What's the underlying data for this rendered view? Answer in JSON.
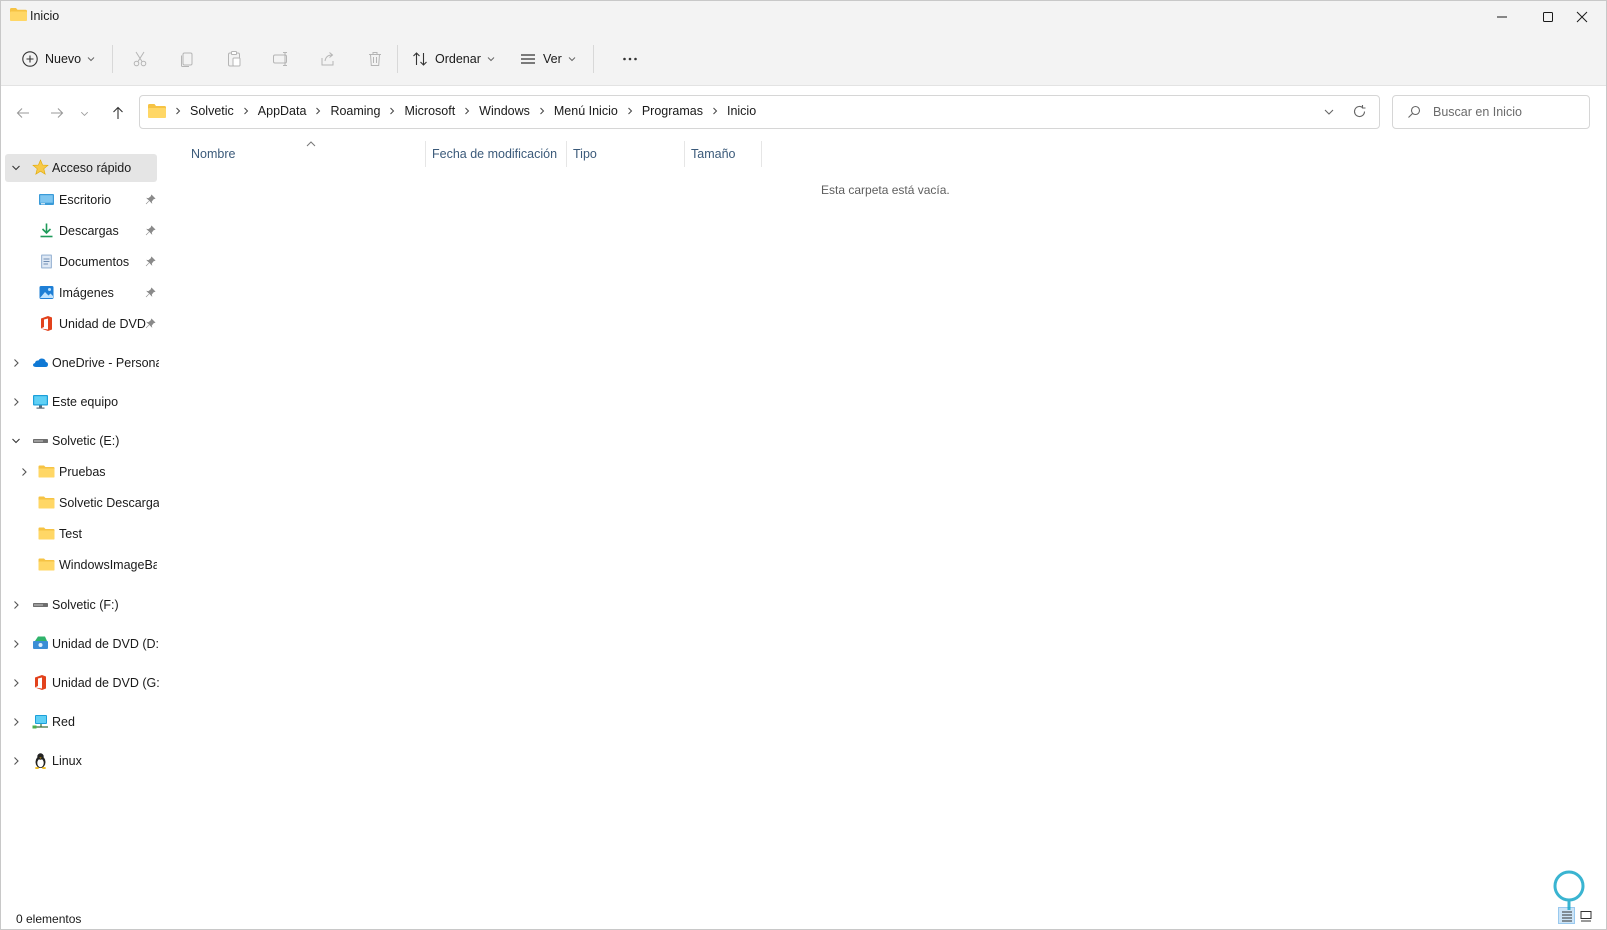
{
  "window": {
    "title": "Inicio",
    "controls": [
      "minimize-icon",
      "maximize-icon",
      "close-icon"
    ]
  },
  "toolbar": {
    "new_label": "Nuevo",
    "sort_label": "Ordenar",
    "view_label": "Ver",
    "icons": [
      "cut-icon",
      "copy-icon",
      "paste-icon",
      "rename-icon",
      "share-icon",
      "delete-icon",
      "more-icon"
    ]
  },
  "address": {
    "crumbs": [
      "Solvetic",
      "AppData",
      "Roaming",
      "Microsoft",
      "Windows",
      "Menú Inicio",
      "Programas",
      "Inicio"
    ]
  },
  "search": {
    "placeholder": "Buscar en Inicio"
  },
  "sidebar": {
    "quick_access": "Acceso rápido",
    "quick_items": [
      {
        "label": "Escritorio",
        "icon": "desktop-icon"
      },
      {
        "label": "Descargas",
        "icon": "download-icon"
      },
      {
        "label": "Documentos",
        "icon": "documents-icon"
      },
      {
        "label": "Imágenes",
        "icon": "pictures-icon"
      },
      {
        "label": "Unidad de DVD",
        "icon": "office-dvd-icon"
      }
    ],
    "onedrive": "OneDrive - Personal",
    "this_pc": "Este equipo",
    "drive_e": "Solvetic (E:)",
    "drive_e_children": [
      "Pruebas",
      "Solvetic Descargas",
      "Test",
      "WindowsImageBackup"
    ],
    "drive_f": "Solvetic (F:)",
    "dvd_d": "Unidad de DVD (D:)",
    "dvd_g": "Unidad de DVD (G:)",
    "network": "Red",
    "linux": "Linux"
  },
  "columns": {
    "name": "Nombre",
    "modified": "Fecha de modificación",
    "type": "Tipo",
    "size": "Tamaño"
  },
  "content": {
    "empty_message": "Esta carpeta está vacía."
  },
  "status": {
    "items": "0 elementos"
  },
  "colors": {
    "folder": "#f6c344",
    "accent": "#0067c0",
    "column_header_text": "#3b5a7a"
  }
}
